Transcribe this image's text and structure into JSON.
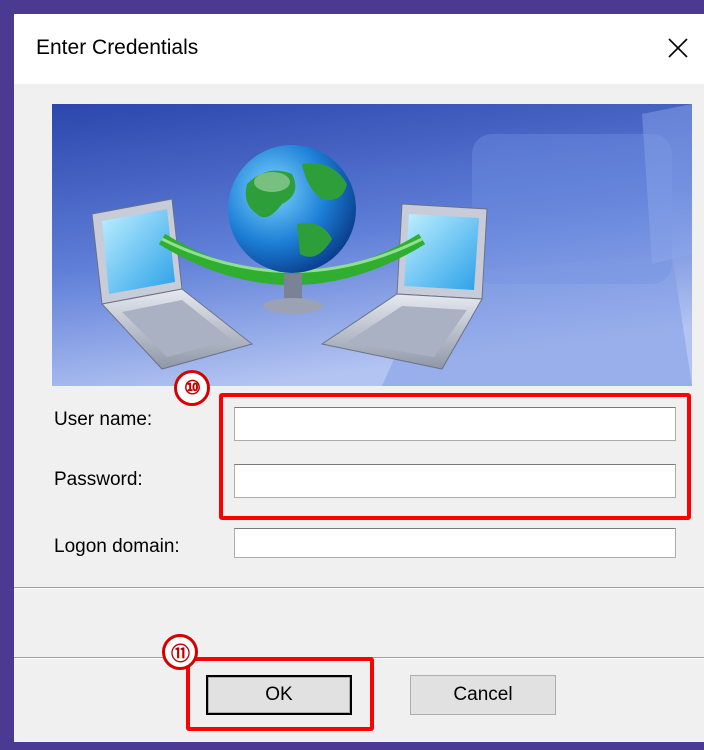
{
  "dialog": {
    "title": "Enter Credentials",
    "close_icon": "close-icon"
  },
  "banner": {
    "icon": "network-globe-laptops-illustration",
    "colors": {
      "sky_top": "#2f4fb4",
      "sky_bottom": "#9fb5ee"
    }
  },
  "form": {
    "username_label": "User name:",
    "username_value": "",
    "password_label": "Password:",
    "password_value": "",
    "domain_label": "Logon domain:",
    "domain_value": ""
  },
  "buttons": {
    "ok_label": "OK",
    "cancel_label": "Cancel"
  },
  "annotations": {
    "step_credentials": "⑩",
    "step_ok": "⑪",
    "highlight_color": "#ff0000"
  }
}
